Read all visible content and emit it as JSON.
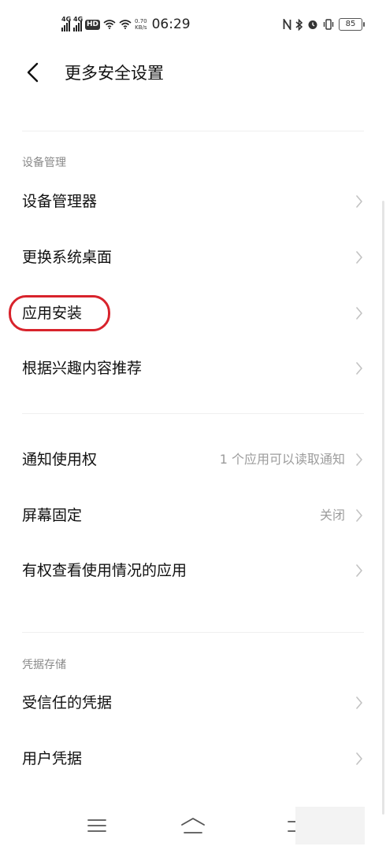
{
  "status_bar": {
    "sim1": "4G",
    "sim2": "4G",
    "hd_badge": "HD",
    "net_speed_value": "0.70",
    "net_speed_unit": "KB/s",
    "time": "06:29",
    "battery": "85",
    "icons": [
      "nfc-icon",
      "bluetooth-icon",
      "alarm-icon",
      "vibrate-icon"
    ]
  },
  "header": {
    "title": "更多安全设置"
  },
  "sections": [
    {
      "label": "设备管理",
      "items": [
        {
          "label": "设备管理器",
          "value": ""
        },
        {
          "label": "更换系统桌面",
          "value": ""
        },
        {
          "label": "应用安装",
          "value": "",
          "highlighted": true
        },
        {
          "label": "根据兴趣内容推荐",
          "value": ""
        }
      ]
    },
    {
      "label": "",
      "items": [
        {
          "label": "通知使用权",
          "value": "1 个应用可以读取通知"
        },
        {
          "label": "屏幕固定",
          "value": "关闭"
        },
        {
          "label": "有权查看使用情况的应用",
          "value": ""
        }
      ]
    },
    {
      "label": "凭据存储",
      "items": [
        {
          "label": "受信任的凭据",
          "value": ""
        },
        {
          "label": "用户凭据",
          "value": ""
        }
      ]
    }
  ],
  "colors": {
    "highlight": "#d8232c",
    "secondary_text": "#9c9c9c",
    "chevron": "#c2c2c2"
  }
}
